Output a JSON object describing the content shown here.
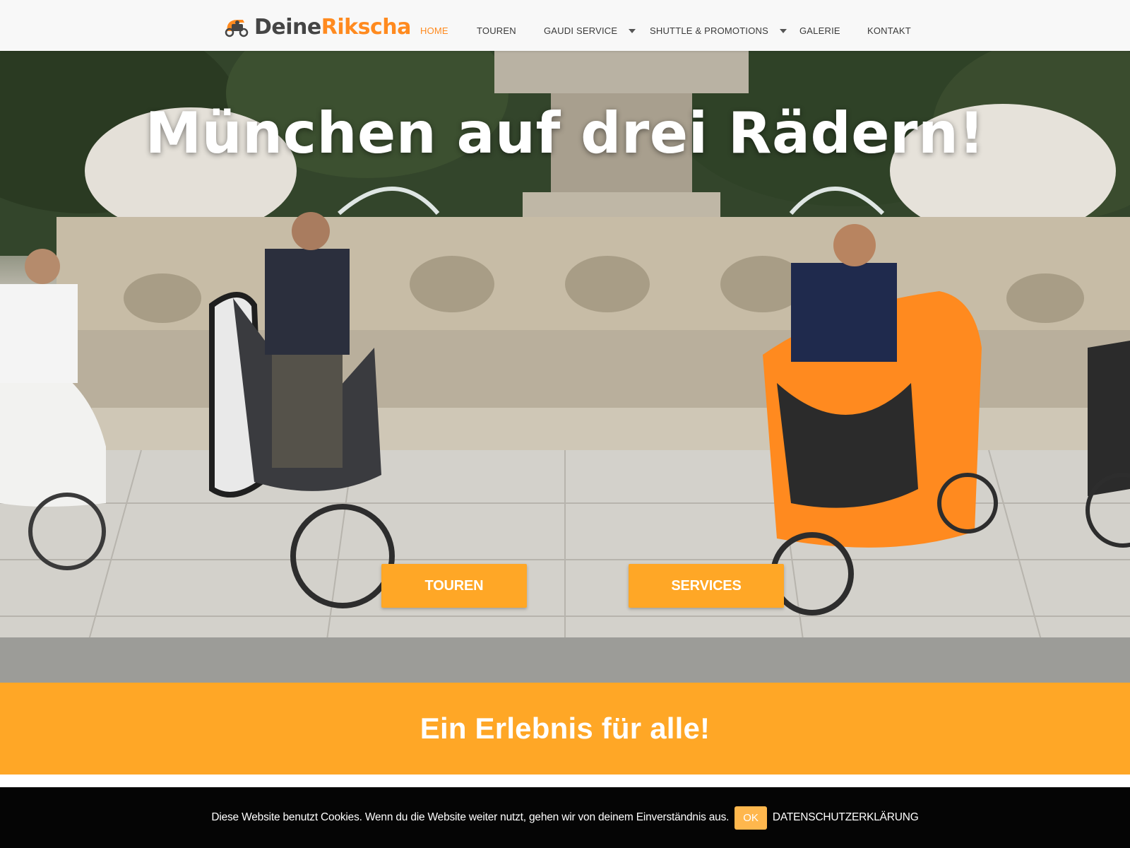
{
  "header": {
    "logo": {
      "part1": "Deine",
      "part2": "Rikscha"
    },
    "nav": [
      {
        "label": "HOME",
        "active": true,
        "dropdown": false
      },
      {
        "label": "TOUREN",
        "active": false,
        "dropdown": false
      },
      {
        "label": "GAUDI SERVICE",
        "active": false,
        "dropdown": true
      },
      {
        "label": "SHUTTLE & PROMOTIONS",
        "active": false,
        "dropdown": true
      },
      {
        "label": "GALERIE",
        "active": false,
        "dropdown": false
      },
      {
        "label": "KONTAKT",
        "active": false,
        "dropdown": false
      }
    ]
  },
  "hero": {
    "title": "München auf drei Rädern!",
    "buttons": {
      "tours": "TOUREN",
      "services": "SERVICES"
    }
  },
  "band": {
    "text": "Ein Erlebnis für alle!"
  },
  "cookie": {
    "text": "Diese Website benutzt Cookies. Wenn du die Website weiter nutzt, gehen wir von deinem Einverständnis aus.",
    "ok": "OK",
    "privacy": "DATENSCHUTZERKLÄRUNG"
  },
  "colors": {
    "accent": "#ff8a1f",
    "button": "#ffa726",
    "cookie_bg": "#050505"
  }
}
